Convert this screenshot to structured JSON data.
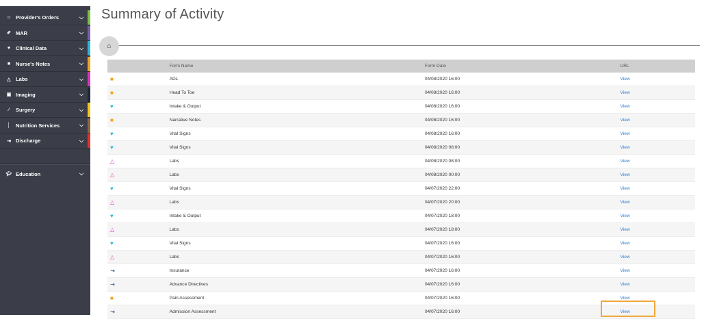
{
  "sidebar": {
    "items": [
      {
        "label": "Provider's Orders",
        "icon": "user-icon",
        "color": "#7ac143"
      },
      {
        "label": "MAR",
        "icon": "syringe-icon",
        "color": "#7b5ea7"
      },
      {
        "label": "Clinical Data",
        "icon": "heart-icon",
        "color": "#2fb4d6"
      },
      {
        "label": "Nurse's Notes",
        "icon": "note-icon",
        "color": "#f2a321"
      },
      {
        "label": "Labs",
        "icon": "flask-icon",
        "color": "#d934b8"
      },
      {
        "label": "Imaging",
        "icon": "image-icon",
        "color": "#1e2a3a"
      },
      {
        "label": "Surgery",
        "icon": "scalpel-icon",
        "color": "#f7c41f"
      },
      {
        "label": "Nutrition Services",
        "icon": "utensils-icon",
        "color": "#8b6a3e"
      },
      {
        "label": "Discharge",
        "icon": "exit-icon",
        "color": "#e03131"
      }
    ],
    "education": {
      "label": "Education",
      "icon": "graduation-cap-icon"
    }
  },
  "page": {
    "title": "Summary of Activity"
  },
  "table": {
    "headers": [
      "Form Name",
      "Form Date",
      "URL"
    ],
    "rows": [
      {
        "icon": "form",
        "name": "ADL",
        "date": "04/08/2020 16:00",
        "url": "View"
      },
      {
        "icon": "form",
        "name": "Head To Toe",
        "date": "04/08/2020 16:00",
        "url": "View"
      },
      {
        "icon": "vital",
        "name": "Intake & Output",
        "date": "04/08/2020 16:00",
        "url": "View"
      },
      {
        "icon": "form",
        "name": "Narrative Notes",
        "date": "04/08/2020 16:00",
        "url": "View"
      },
      {
        "icon": "vital",
        "name": "Vital Signs",
        "date": "04/08/2020 16:00",
        "url": "View"
      },
      {
        "icon": "vital",
        "name": "Vital Signs",
        "date": "04/08/2020 08:00",
        "url": "View"
      },
      {
        "icon": "lab",
        "name": "Labs",
        "date": "04/08/2020 08:00",
        "url": "View"
      },
      {
        "icon": "lab",
        "name": "Labs",
        "date": "04/08/2020 00:00",
        "url": "View"
      },
      {
        "icon": "vital",
        "name": "Vital Signs",
        "date": "04/07/2020 22:00",
        "url": "View"
      },
      {
        "icon": "lab",
        "name": "Labs",
        "date": "04/07/2020 20:00",
        "url": "View"
      },
      {
        "icon": "vital",
        "name": "Intake & Output",
        "date": "04/07/2020 18:00",
        "url": "View"
      },
      {
        "icon": "lab",
        "name": "Labs",
        "date": "04/07/2020 18:00",
        "url": "View"
      },
      {
        "icon": "vital",
        "name": "Vital Signs",
        "date": "04/07/2020 16:00",
        "url": "View"
      },
      {
        "icon": "lab",
        "name": "Labs",
        "date": "04/07/2020 16:00",
        "url": "View"
      },
      {
        "icon": "doc",
        "name": "Insurance",
        "date": "04/07/2020 16:00",
        "url": "View"
      },
      {
        "icon": "doc",
        "name": "Advance Directives",
        "date": "04/07/2020 16:00",
        "url": "View"
      },
      {
        "icon": "form",
        "name": "Pain Assessment",
        "date": "04/07/2020 16:00",
        "url": "View"
      },
      {
        "icon": "doc",
        "name": "Admission Assessment",
        "date": "04/07/2020 16:00",
        "url": "View"
      }
    ]
  },
  "highlight_color": "#f0a73a"
}
